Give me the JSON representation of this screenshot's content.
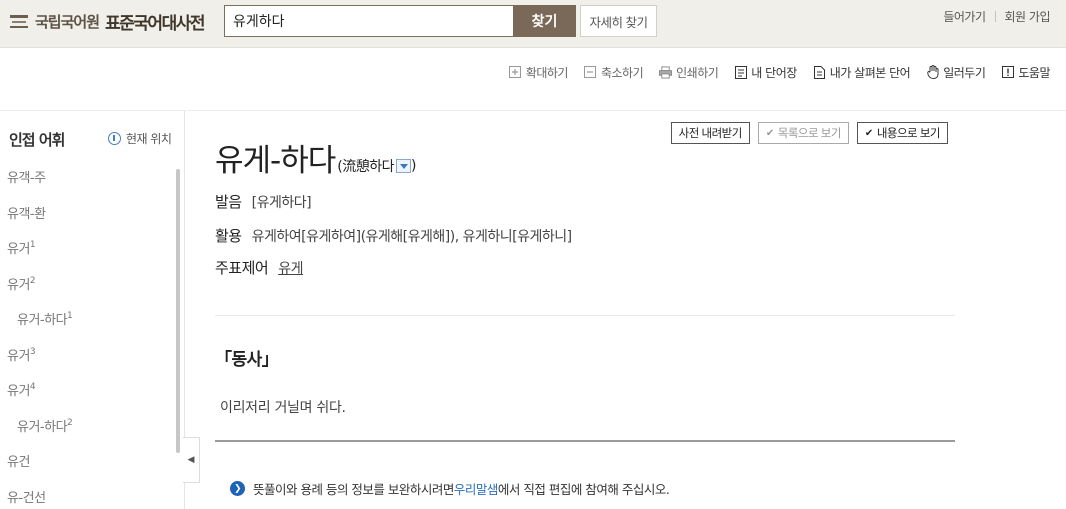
{
  "header": {
    "org_name": "국립국어원",
    "dict_name": "표준국어대사전",
    "search": {
      "value": "유게하다"
    },
    "search_button": "찾기",
    "detail_button": "자세히 찾기",
    "login": "들어가기",
    "signup": "회원 가입"
  },
  "toolbar": {
    "zoom_in": "확대하기",
    "zoom_out": "축소하기",
    "print": "인쇄하기",
    "my_words": "내 단어장",
    "viewed_words": "내가 살펴본 단어",
    "notify": "일러두기",
    "help": "도움말"
  },
  "sidebar": {
    "title": "인접 어휘",
    "location": "현재 위치",
    "items": [
      {
        "label": "유객-주",
        "sup": ""
      },
      {
        "label": "유객-환",
        "sup": ""
      },
      {
        "label": "유거",
        "sup": "1"
      },
      {
        "label": "유거",
        "sup": "2"
      },
      {
        "label": "유거-하다",
        "sup": "1"
      },
      {
        "label": "유거",
        "sup": "3"
      },
      {
        "label": "유거",
        "sup": "4"
      },
      {
        "label": "유거-하다",
        "sup": "2"
      },
      {
        "label": "유건",
        "sup": ""
      },
      {
        "label": "유-건선",
        "sup": ""
      }
    ]
  },
  "content": {
    "btn_download": "사전 내려받기",
    "btn_list_view": "목록으로 보기",
    "btn_content_view": "내용으로 보기",
    "headword": "유게-하다",
    "origin": "(流憩하다",
    "origin_close": ")",
    "pron_label": "발음",
    "pron_value": "[유게하다]",
    "conj_label": "활용",
    "conj_value": "유게하여[유게하여](유게해[유게해]), 유게하니[유게하니]",
    "root_label": "주표제어",
    "root_value": "유게",
    "pos": "「동사」",
    "definition": "이리저리 거닐며 쉬다.",
    "notice_pre": "뜻풀이와 용례 등의 정보를 보완하시려면 ",
    "notice_link": "우리말샘",
    "notice_post": "에서 직접 편집에 참여해 주십시오."
  },
  "colors": {
    "header_bg": "#f1efe9",
    "search_button": "#7a6859",
    "link_blue": "#2a6fc0"
  }
}
